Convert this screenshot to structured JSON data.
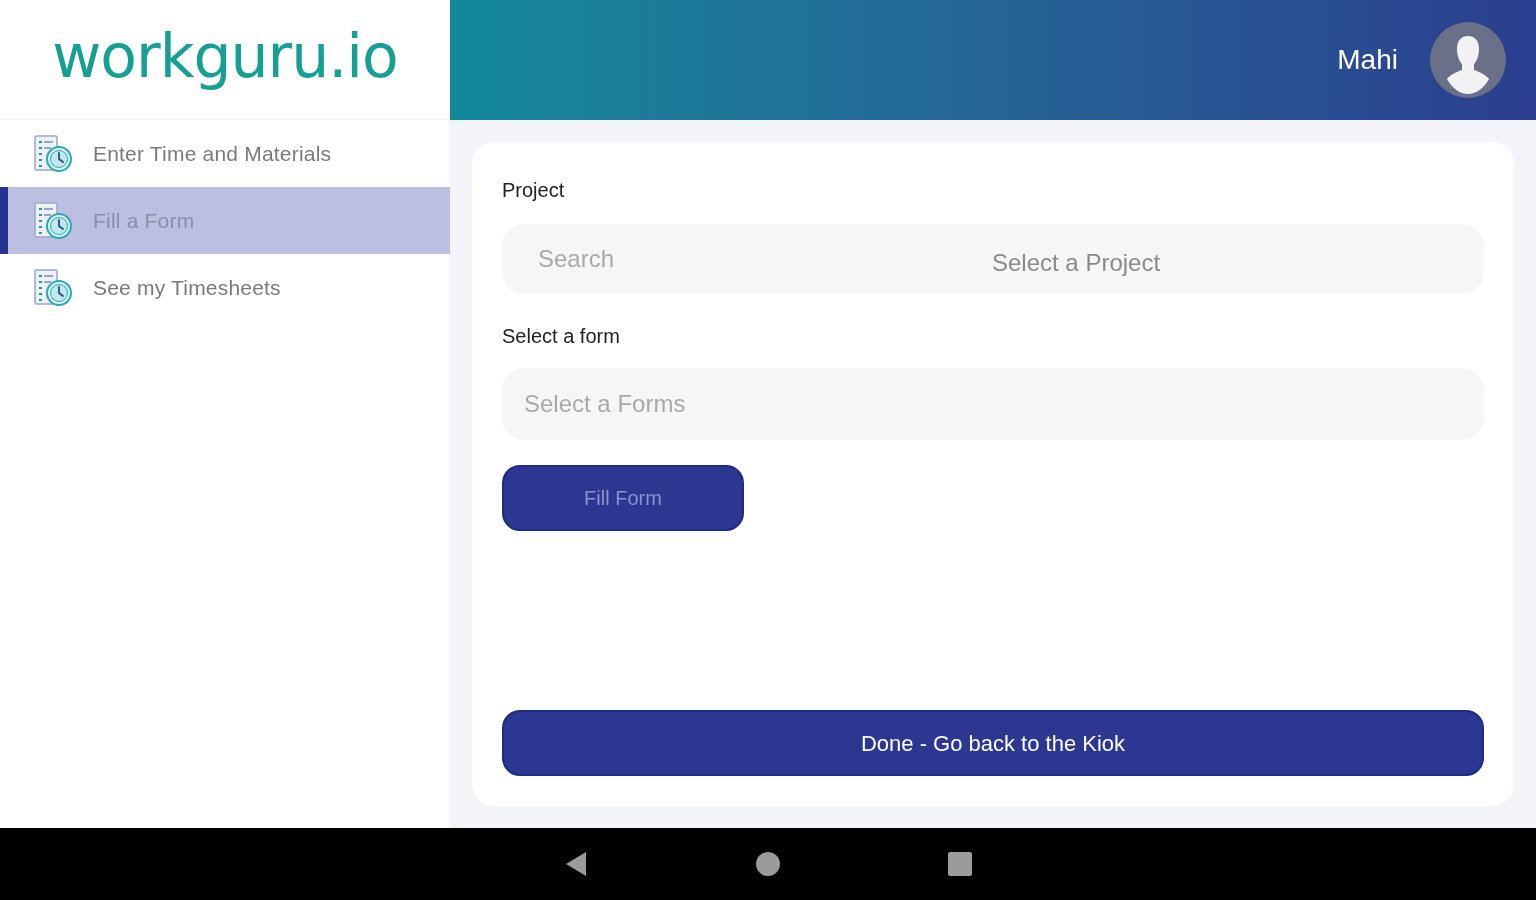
{
  "sidebar": {
    "logo": "workguru.io",
    "items": [
      {
        "label": "Enter Time and Materials",
        "selected": false
      },
      {
        "label": "Fill a Form",
        "selected": true
      },
      {
        "label": "See my Timesheets",
        "selected": false
      }
    ]
  },
  "header": {
    "user_name": "Mahi"
  },
  "form": {
    "fields": [
      {
        "kind": "search-select",
        "label": "Project",
        "placeholder": "Search",
        "prompt": "Select a Project"
      },
      {
        "kind": "select",
        "label": "Select a form",
        "placeholder": "Select a Forms"
      }
    ],
    "fill_button": {
      "label": "Fill Form",
      "disabled": true
    },
    "done_button": {
      "label": "Done - Go back to the Kiok"
    }
  }
}
